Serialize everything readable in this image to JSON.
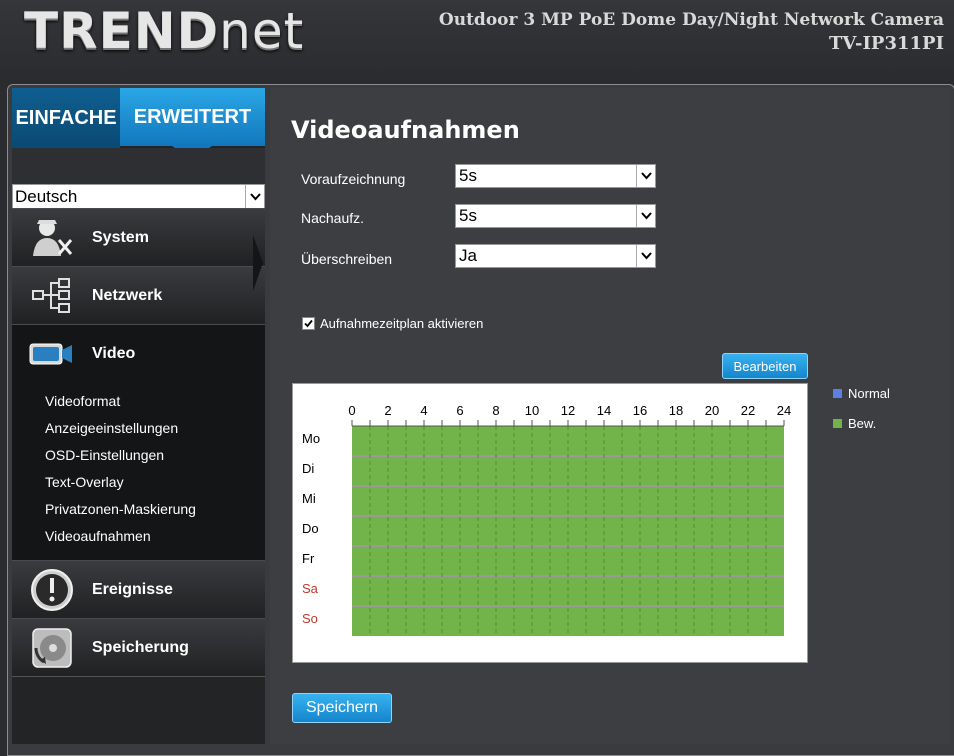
{
  "header": {
    "logo_bold": "TREND",
    "logo_thin": "net",
    "product_line": "Outdoor 3 MP PoE Dome Day/Night Network Camera",
    "model": "TV-IP311PI"
  },
  "mode_tabs": {
    "basic": "EINFACHE",
    "advanced": "ERWEITERT"
  },
  "language": {
    "selected": "Deutsch"
  },
  "nav": [
    {
      "label": "System",
      "icon": "system-admin-icon"
    },
    {
      "label": "Netzwerk",
      "icon": "network-icon"
    },
    {
      "label": "Video",
      "icon": "video-camera-icon",
      "active": true
    },
    {
      "label": "Ereignisse",
      "icon": "alert-icon"
    },
    {
      "label": "Speicherung",
      "icon": "storage-icon"
    }
  ],
  "submenu": [
    "Videoformat",
    "Anzeigeeinstellungen",
    "OSD-Einstellungen",
    "Text-Overlay",
    "Privatzonen-Maskierung",
    "Videoaufnahmen"
  ],
  "page": {
    "title": "Videoaufnahmen",
    "fields": [
      {
        "label": "Voraufzeichnung",
        "value": "5s"
      },
      {
        "label": "Nachaufz.",
        "value": "5s"
      },
      {
        "label": "Überschreiben",
        "value": "Ja"
      }
    ],
    "schedule_checkbox": {
      "label": "Aufnahmezeitplan aktivieren",
      "checked": true
    },
    "edit_button": "Bearbeiten",
    "save_button": "Speichern"
  },
  "schedule": {
    "hour_labels": [
      "0",
      "2",
      "4",
      "6",
      "8",
      "10",
      "12",
      "14",
      "16",
      "18",
      "20",
      "22",
      "24"
    ],
    "days": [
      "Mo",
      "Di",
      "Mi",
      "Do",
      "Fr",
      "Sa",
      "So"
    ],
    "weekend_color": "#c0392b",
    "fill_color": "#72b44a"
  },
  "legend": [
    {
      "label": "Normal",
      "color": "#5b7fe6"
    },
    {
      "label": "Bew.",
      "color": "#72b44a"
    }
  ]
}
